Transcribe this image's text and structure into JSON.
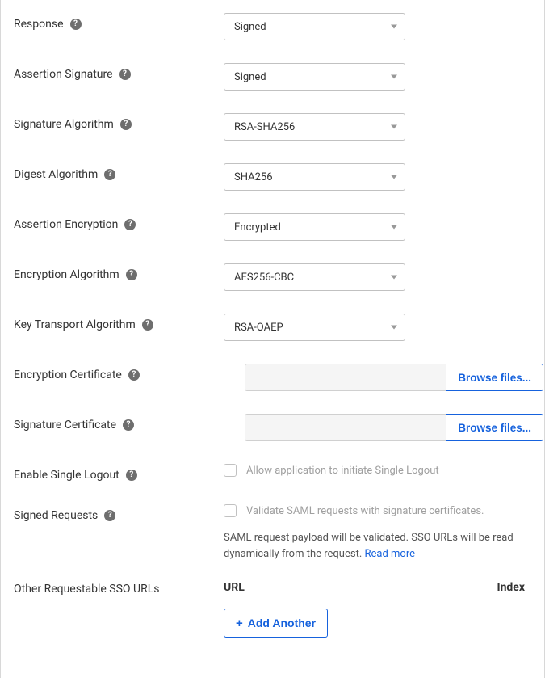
{
  "fields": {
    "response": {
      "label": "Response",
      "value": "Signed"
    },
    "assertion_signature": {
      "label": "Assertion Signature",
      "value": "Signed"
    },
    "signature_algorithm": {
      "label": "Signature Algorithm",
      "value": "RSA-SHA256"
    },
    "digest_algorithm": {
      "label": "Digest Algorithm",
      "value": "SHA256"
    },
    "assertion_encryption": {
      "label": "Assertion Encryption",
      "value": "Encrypted"
    },
    "encryption_algorithm": {
      "label": "Encryption Algorithm",
      "value": "AES256-CBC"
    },
    "key_transport_algorithm": {
      "label": "Key Transport Algorithm",
      "value": "RSA-OAEP"
    },
    "encryption_certificate": {
      "label": "Encryption Certificate",
      "browse": "Browse files..."
    },
    "signature_certificate": {
      "label": "Signature Certificate",
      "browse": "Browse files..."
    },
    "enable_single_logout": {
      "label": "Enable Single Logout",
      "checkbox_label": "Allow application to initiate Single Logout"
    },
    "signed_requests": {
      "label": "Signed Requests",
      "checkbox_label": "Validate SAML requests with signature certificates.",
      "description": "SAML request payload will be validated. SSO URLs will be read dynamically from the request. ",
      "read_more": "Read more"
    },
    "other_sso_urls": {
      "label": "Other Requestable SSO URLs",
      "header_url": "URL",
      "header_index": "Index",
      "add_button": "Add Another"
    }
  },
  "help_glyph": "?"
}
